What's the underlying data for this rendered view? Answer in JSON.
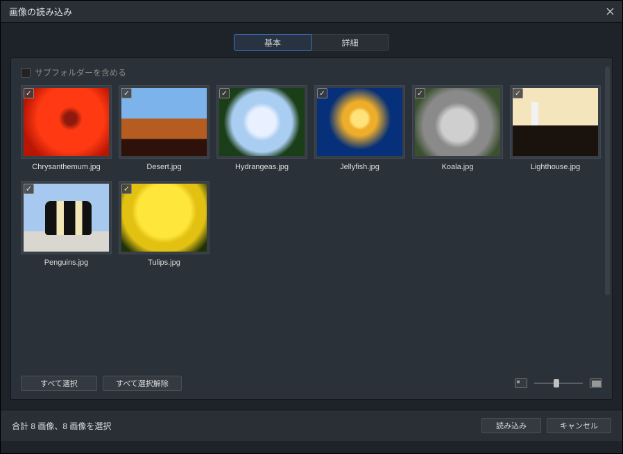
{
  "window": {
    "title": "画像の読み込み",
    "close_icon": "close-icon"
  },
  "tabs": {
    "basic": "基本",
    "detail": "詳細",
    "active": "basic"
  },
  "subfolder": {
    "label": "サブフォルダーを含める",
    "checked": false
  },
  "images": [
    {
      "filename": "Chrysanthemum.jpg",
      "selected": true,
      "thumb_class": "img-chrys"
    },
    {
      "filename": "Desert.jpg",
      "selected": true,
      "thumb_class": "img-desert"
    },
    {
      "filename": "Hydrangeas.jpg",
      "selected": true,
      "thumb_class": "img-hydr"
    },
    {
      "filename": "Jellyfish.jpg",
      "selected": true,
      "thumb_class": "img-jelly"
    },
    {
      "filename": "Koala.jpg",
      "selected": true,
      "thumb_class": "img-koala"
    },
    {
      "filename": "Lighthouse.jpg",
      "selected": true,
      "thumb_class": "img-light"
    },
    {
      "filename": "Penguins.jpg",
      "selected": true,
      "thumb_class": "img-peng"
    },
    {
      "filename": "Tulips.jpg",
      "selected": true,
      "thumb_class": "img-tulip"
    }
  ],
  "buttons": {
    "select_all": "すべて選択",
    "deselect_all": "すべて選択解除",
    "import": "読み込み",
    "cancel": "キャンセル"
  },
  "status": {
    "text": "合計 8 画像、8 画像を選択"
  },
  "zoom": {
    "value": 0.4
  }
}
